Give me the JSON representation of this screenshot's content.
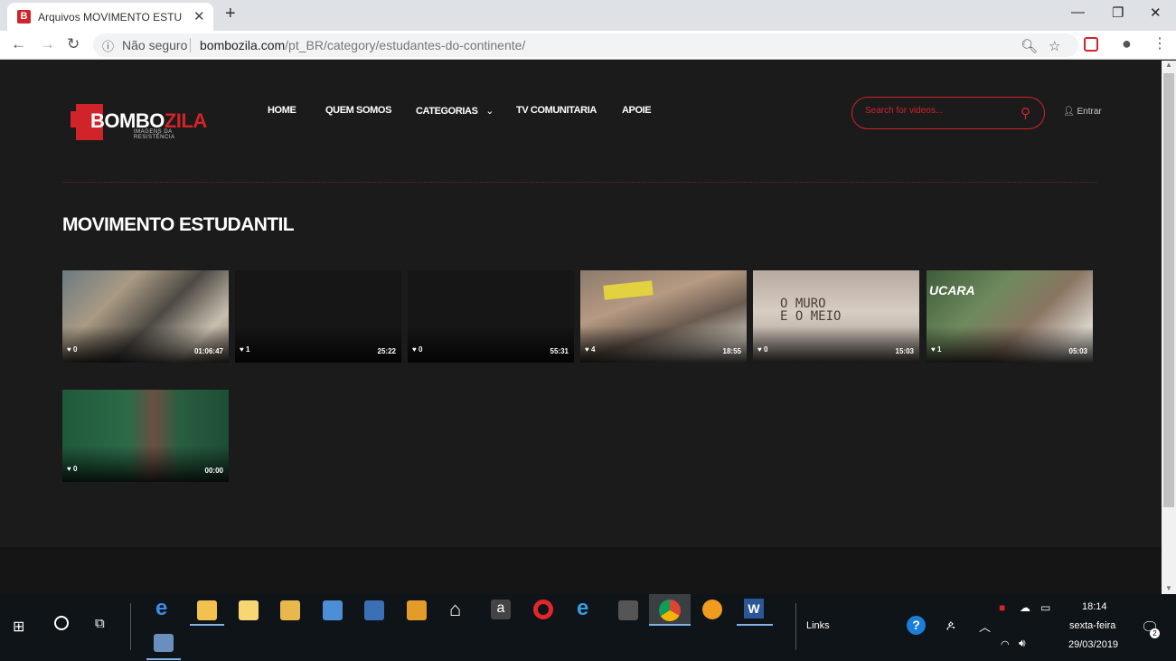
{
  "browser": {
    "tab_title": "Arquivos MOVIMENTO ESTUDAN",
    "tab_favicon": "B",
    "security_label": "Não seguro",
    "url_domain": "bombozila.com",
    "url_path": "/pt_BR/category/estudantes-do-continente/"
  },
  "site": {
    "logo_main": "BOMBO",
    "logo_accent": "ZILA",
    "logo_subtitle": "IMAGENS DA RESISTÊNCIA",
    "menu": {
      "home": "HOME",
      "about": "QUEM SOMOS",
      "categories": "CATEGORIAS",
      "tv": "TV COMUNITARIA",
      "support": "APOIE"
    },
    "search_placeholder": "Search for videos...",
    "login": "Entrar",
    "accent_color": "#d1232a"
  },
  "page": {
    "heading": "MOVIMENTO ESTUDANTIL",
    "videos": [
      {
        "likes": "0",
        "duration": "01:06:47",
        "thumb": "crowd-photo"
      },
      {
        "likes": "1",
        "duration": "25:22",
        "thumb": "dark"
      },
      {
        "likes": "0",
        "duration": "55:31",
        "thumb": "dark"
      },
      {
        "likes": "4",
        "duration": "18:55",
        "thumb": "students-lying"
      },
      {
        "likes": "0",
        "duration": "15:03",
        "thumb": "o-muro-e-o-meio"
      },
      {
        "likes": "1",
        "duration": "05:03",
        "thumb": "ucara-outdoor"
      },
      {
        "likes": "0",
        "duration": "00:00",
        "thumb": "woman-chalkboard"
      }
    ],
    "thumb_text": {
      "muro_line1": "O MURO",
      "muro_line2": "E O MEIO",
      "ucara": "UCARA"
    }
  },
  "taskbar": {
    "links_label": "Links",
    "time": "18:14",
    "day": "sexta-feira",
    "date": "29/03/2019",
    "notifications": "2"
  }
}
